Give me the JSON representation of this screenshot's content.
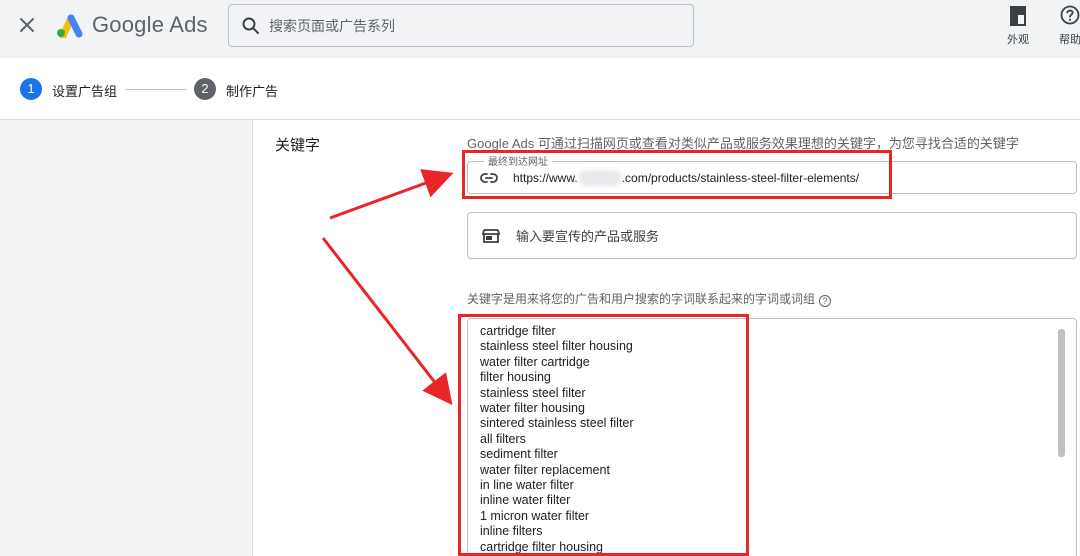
{
  "header": {
    "brand": "Google Ads",
    "search_placeholder": "搜索页面或广告系列",
    "tools": [
      {
        "label": "外观",
        "icon": "appearance-icon"
      },
      {
        "label": "帮助",
        "icon": "help-icon"
      }
    ]
  },
  "steps": [
    {
      "number": "1",
      "label": "设置广告组",
      "active": true
    },
    {
      "number": "2",
      "label": "制作广告",
      "active": false
    }
  ],
  "keywords_section": {
    "title": "关键字",
    "hint": "Google Ads 可通过扫描网页或查看对类似产品或服务效果理想的关键字，为您寻找合适的关键字",
    "url_field": {
      "label": "最终到达网址",
      "prefix": "https://www.",
      "suffix": ".com/products/stainless-steel-filter-elements/"
    },
    "product_field_placeholder": "输入要宣传的产品或服务",
    "keywords_label": "关键字是用来将您的广告和用户搜索的字词联系起来的字词或词组",
    "keywords": [
      "cartridge filter",
      "stainless steel filter housing",
      "water filter cartridge",
      "filter housing",
      "stainless steel filter",
      "water filter housing",
      "sintered stainless steel filter",
      "all filters",
      "sediment filter",
      "water filter replacement",
      "in line water filter",
      "inline water filter",
      "1 micron water filter",
      "inline filters",
      "cartridge filter housing"
    ]
  },
  "colors": {
    "accent": "#1a73e8",
    "annotation_red": "#e8262a",
    "step_inactive": "#5f6368"
  }
}
